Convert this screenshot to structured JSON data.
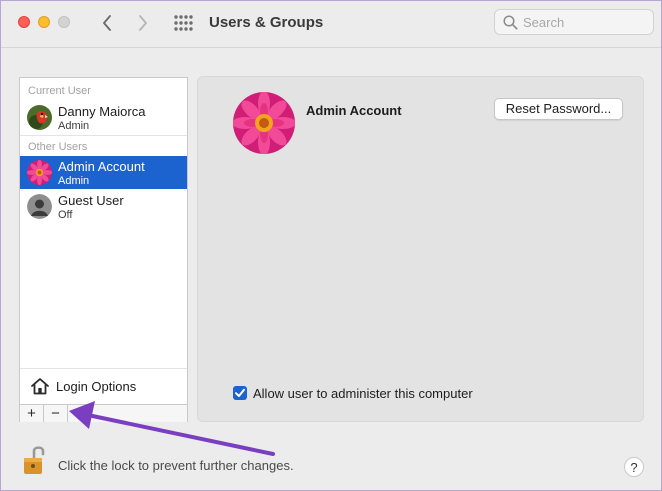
{
  "window": {
    "title": "Users & Groups"
  },
  "search": {
    "placeholder": "Search",
    "value": ""
  },
  "sidebar": {
    "current_user_label": "Current User",
    "other_users_label": "Other Users",
    "current_user": {
      "name": "Danny Maiorca",
      "role": "Admin"
    },
    "other_users": [
      {
        "name": "Admin Account",
        "role": "Admin",
        "selected": true
      },
      {
        "name": "Guest User",
        "role": "Off",
        "selected": false
      }
    ],
    "login_options_label": "Login Options",
    "add_label": "+",
    "remove_label": "−"
  },
  "detail": {
    "account_name": "Admin Account",
    "reset_password_label": "Reset Password...",
    "allow_admin_label": "Allow user to administer this computer",
    "allow_admin_checked": true
  },
  "footer": {
    "lock_text": "Click the lock to prevent further changes.",
    "help_label": "?"
  },
  "colors": {
    "accent": "#1d63d0",
    "annotation_arrow": "#7a3fc0"
  },
  "icons": {
    "back": "chevron-left-icon",
    "forward": "chevron-right-icon",
    "grid": "grid-icon",
    "search": "search-icon",
    "home": "home-icon",
    "lock": "lock-open-icon",
    "help": "help-icon"
  }
}
